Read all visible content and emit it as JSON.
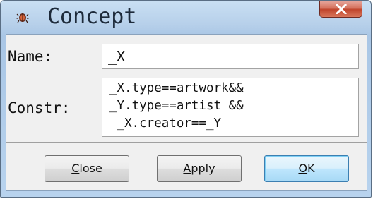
{
  "window": {
    "title": "Concept",
    "app_icon": "bug-icon",
    "close_icon": "close-x-icon"
  },
  "form": {
    "name_label": "Name:",
    "name_value": "_X",
    "constr_label": "Constr:",
    "constr_lines": [
      "_X.type==artwork&&",
      "_Y.type==artist &&",
      " _X.creator==_Y"
    ]
  },
  "buttons": {
    "close": {
      "mnemonic": "C",
      "rest": "lose"
    },
    "apply": {
      "mnemonic": "A",
      "rest": "pply"
    },
    "ok": {
      "mnemonic": "O",
      "rest": "K"
    }
  },
  "colors": {
    "titlebar": "#b8d3ee",
    "close_button": "#c0452c",
    "default_button_border": "#3c7fb1"
  }
}
